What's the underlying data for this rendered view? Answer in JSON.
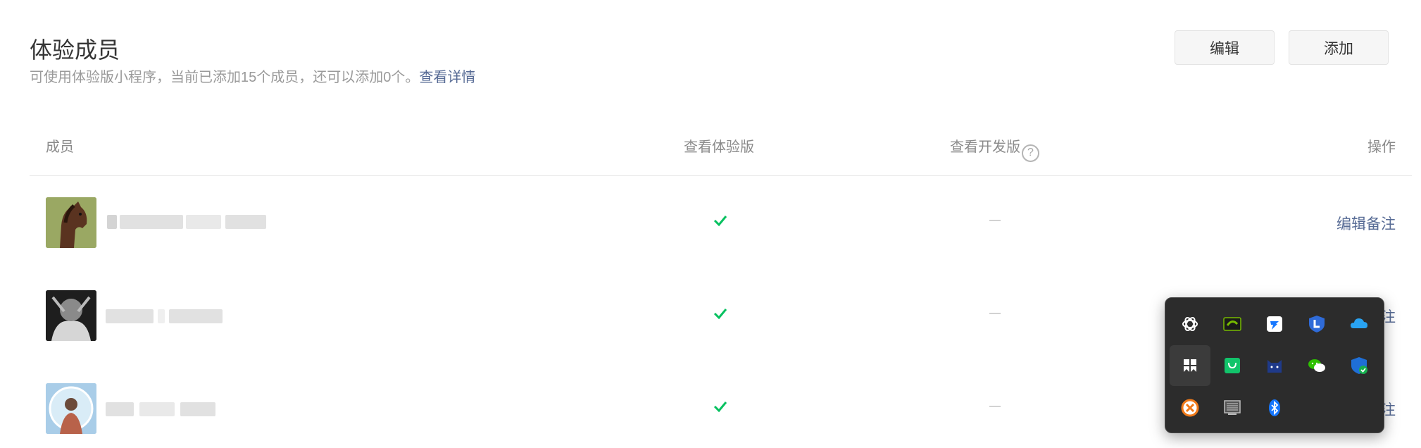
{
  "header": {
    "title": "体验成员",
    "desc_text": "可使用体验版小程序，当前已添加15个成员，还可以添加0个。",
    "desc_link": "查看详情",
    "edit_label": "编辑",
    "add_label": "添加"
  },
  "table": {
    "columns": {
      "member": "成员",
      "view_trial": "查看体验版",
      "view_dev": "查看开发版",
      "help": "?",
      "action": "操作"
    },
    "rows": [
      {
        "view_trial": true,
        "view_dev": false,
        "action": "编辑备注"
      },
      {
        "view_trial": true,
        "view_dev": false,
        "action": "编辑备注"
      },
      {
        "view_trial": true,
        "view_dev": false,
        "action": "编辑备注"
      }
    ]
  },
  "tray": {
    "icons": [
      "chatgpt-icon",
      "nvidia-icon",
      "tencent-meeting-icon",
      "lenovo-shield-icon",
      "onedrive-icon",
      "app-grid-icon",
      "shopping-bag-icon",
      "cat-app-icon",
      "wechat-icon",
      "windows-security-icon",
      "close-circle-icon",
      "monitor-icon",
      "bluetooth-icon"
    ]
  },
  "colors": {
    "link": "#576b95",
    "check": "#07c160",
    "tray_bg": "#2c2c2c"
  }
}
